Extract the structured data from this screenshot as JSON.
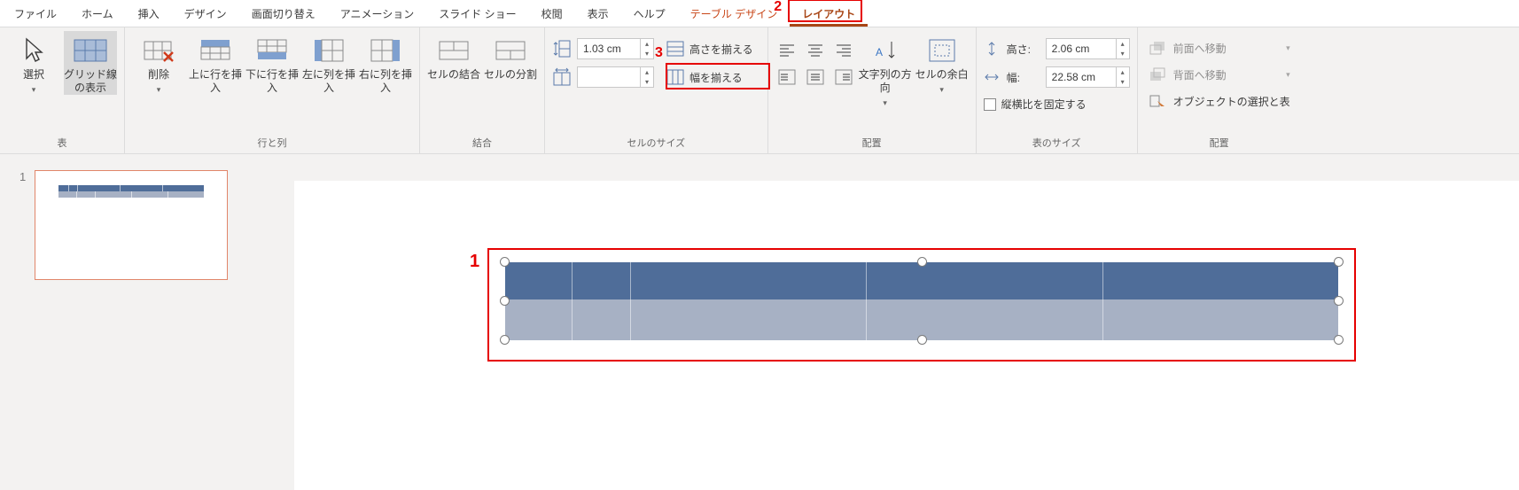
{
  "menubar": {
    "items": [
      "ファイル",
      "ホーム",
      "挿入",
      "デザイン",
      "画面切り替え",
      "アニメーション",
      "スライド ショー",
      "校閲",
      "表示",
      "ヘルプ",
      "テーブル デザイン",
      "レイアウト"
    ],
    "brown_index": 10,
    "active_index": 11
  },
  "ribbon": {
    "groups": {
      "table": {
        "label": "表",
        "select": "選択",
        "gridlines": "グリッド線の表示"
      },
      "rows_cols": {
        "label": "行と列",
        "delete": "削除",
        "row_above": "上に行を挿入",
        "row_below": "下に行を挿入",
        "col_left": "左に列を挿入",
        "col_right": "右に列を挿入"
      },
      "merge": {
        "label": "結合",
        "merge_cells": "セルの結合",
        "split_cells": "セルの分割"
      },
      "cell_size": {
        "label": "セルのサイズ",
        "height_value": "1.03 cm",
        "width_value": "",
        "dist_rows": "高さを揃える",
        "dist_cols": "幅を揃える"
      },
      "alignment": {
        "label": "配置",
        "text_dir": "文字列の方向",
        "cell_margins": "セルの余白"
      },
      "table_size": {
        "label": "表のサイズ",
        "height_label": "高さ:",
        "height_value": "2.06 cm",
        "width_label": "幅:",
        "width_value": "22.58 cm",
        "lock_ratio": "縦横比を固定する"
      },
      "arrange": {
        "label": "配置",
        "bring_forward": "前面へ移動",
        "send_backward": "背面へ移動",
        "selection_pane": "オブジェクトの選択と表"
      }
    }
  },
  "thumbs": {
    "num": "1"
  },
  "annotations": {
    "n1": "1",
    "n2": "2",
    "n3": "3"
  },
  "colors": {
    "accent": "#c84618",
    "ann": "#e60000",
    "blue1": "#4f6d99",
    "blue2": "#a7b1c4"
  }
}
